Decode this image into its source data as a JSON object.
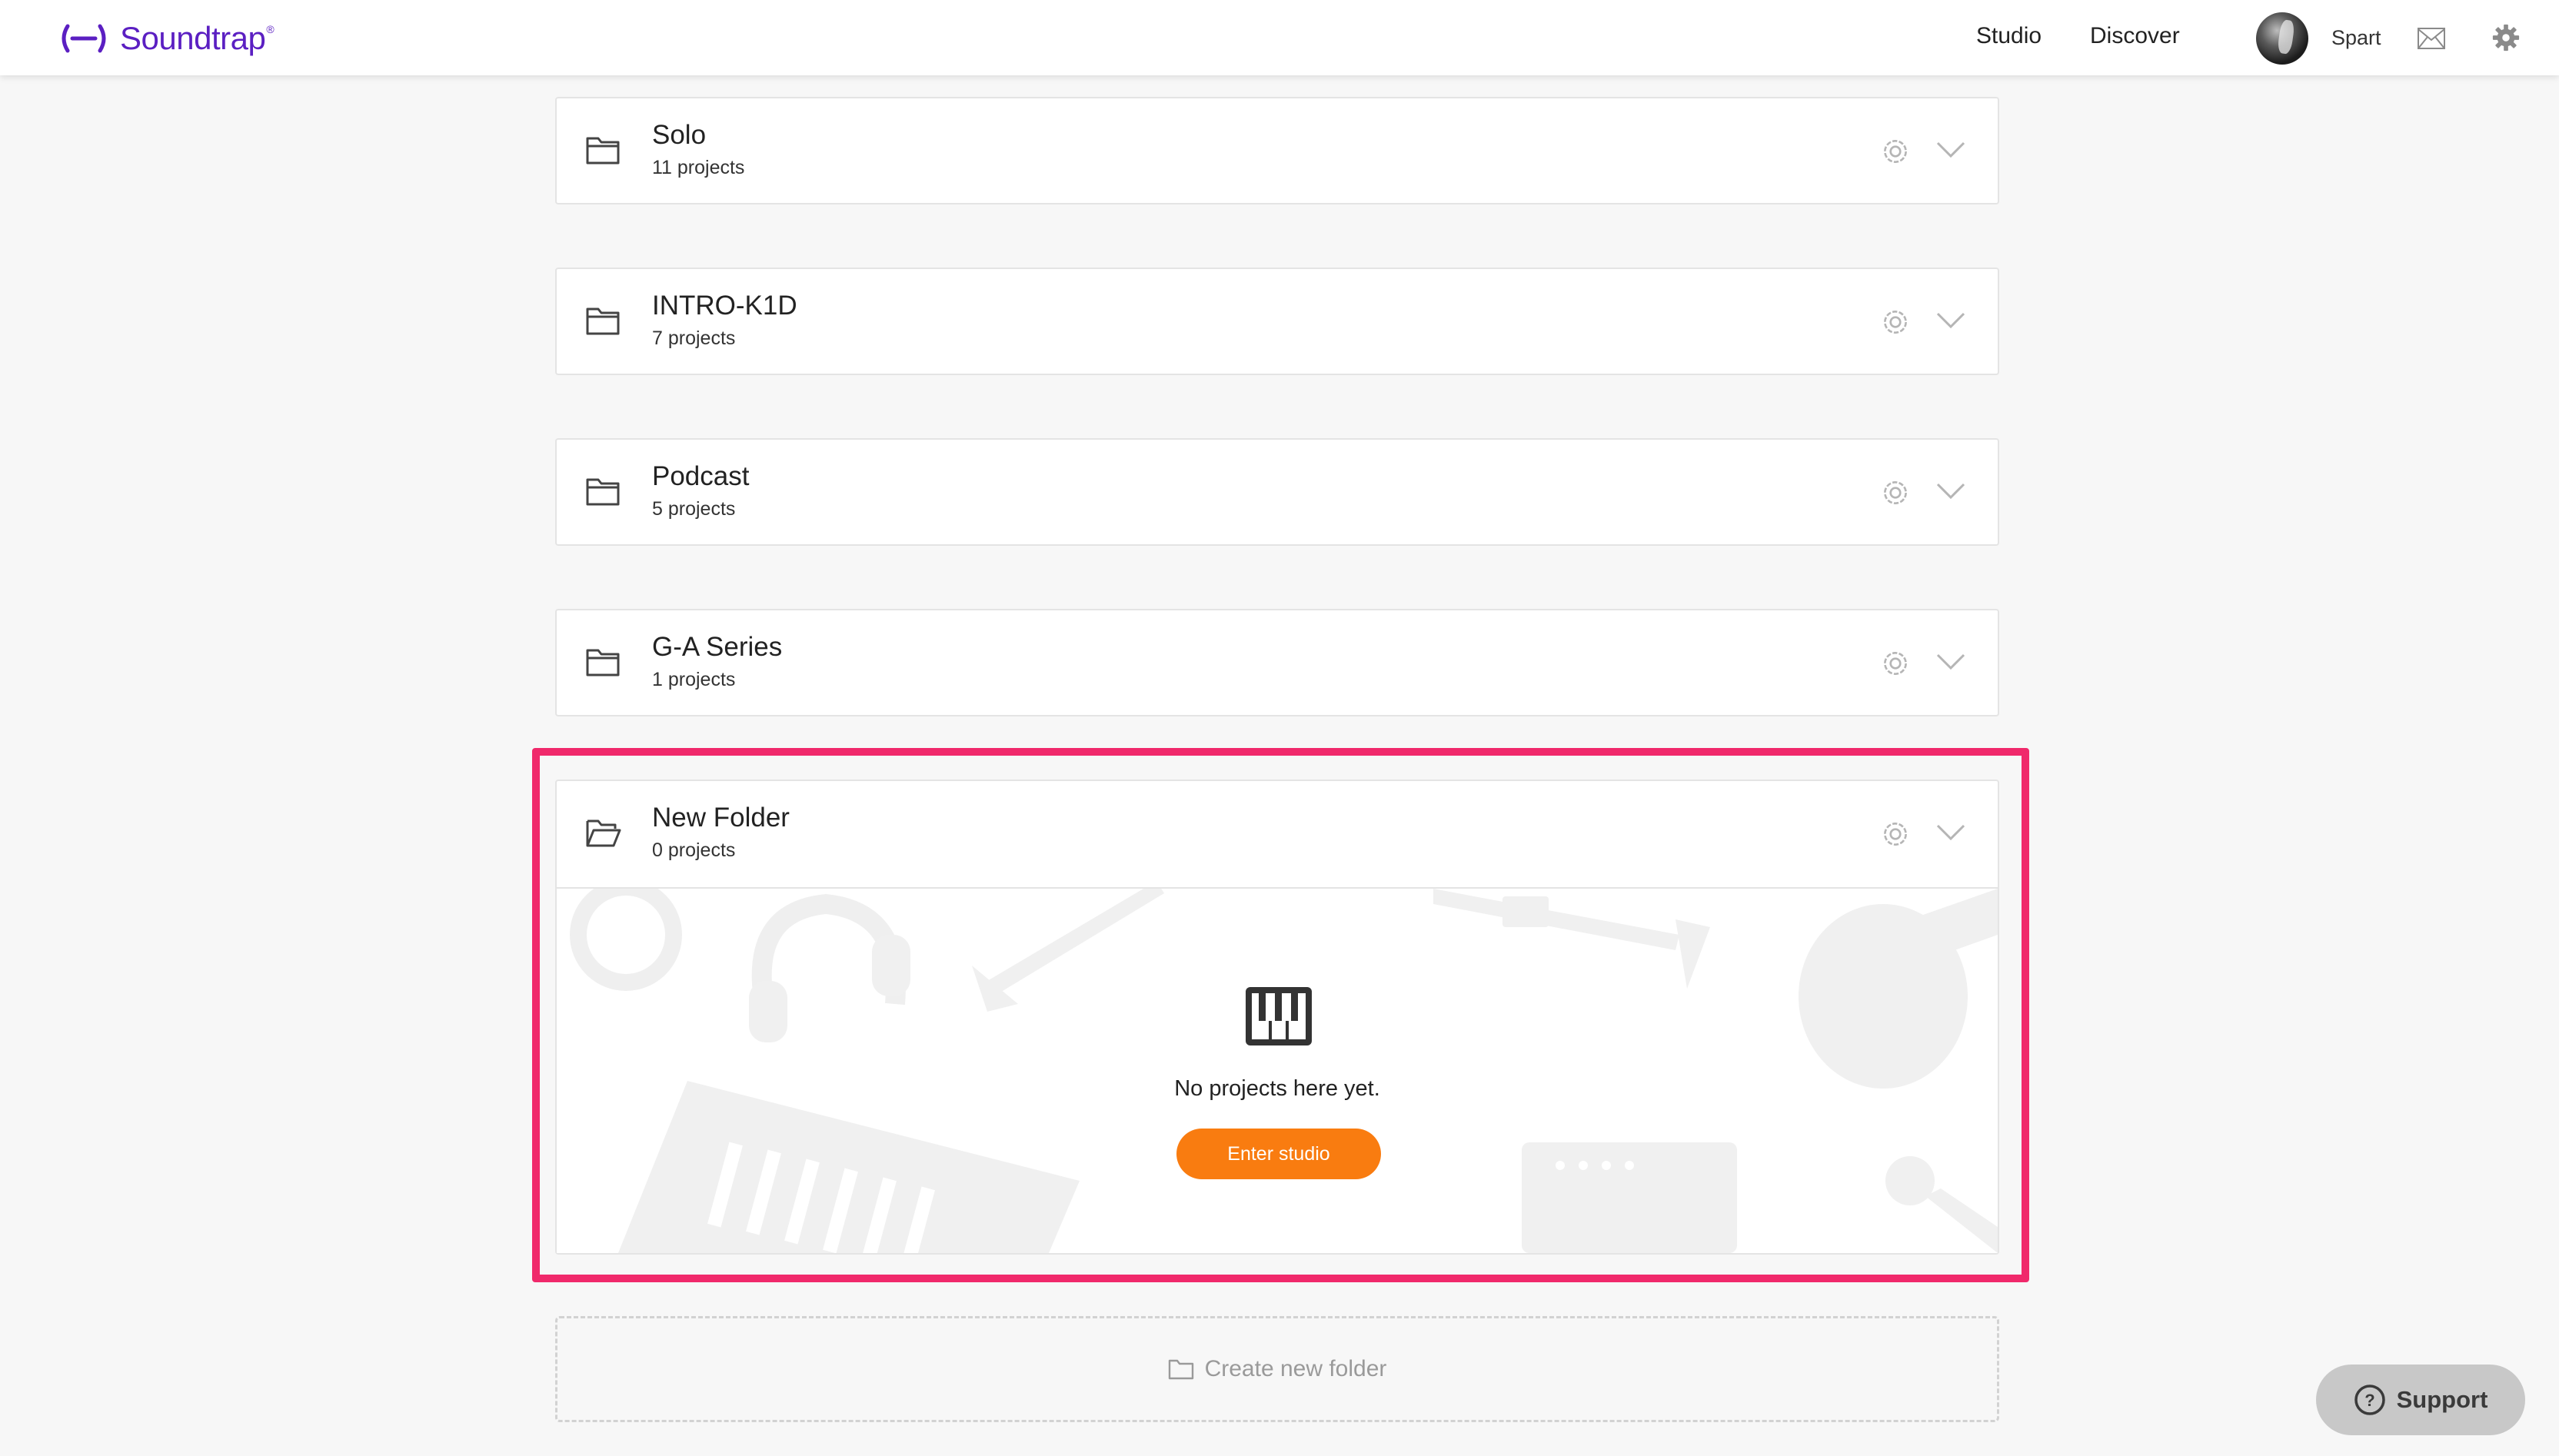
{
  "header": {
    "logo_text": "Soundtrap",
    "nav": [
      {
        "label": "Studio"
      },
      {
        "label": "Discover"
      }
    ],
    "username": "Spart"
  },
  "folders": [
    {
      "name": "Solo",
      "count": "11 projects"
    },
    {
      "name": "INTRO-K1D",
      "count": "7 projects"
    },
    {
      "name": "Podcast",
      "count": "5 projects"
    },
    {
      "name": "G-A Series",
      "count": "1 projects"
    },
    {
      "name": "New Folder",
      "count": "0 projects",
      "expanded": true
    }
  ],
  "empty_state": {
    "message": "No projects here yet.",
    "button_label": "Enter studio"
  },
  "create_folder_label": "Create new folder",
  "support_label": "Support",
  "colors": {
    "brand": "#5b1fc2",
    "accent_button": "#f97c10",
    "highlight": "#f0296b"
  }
}
